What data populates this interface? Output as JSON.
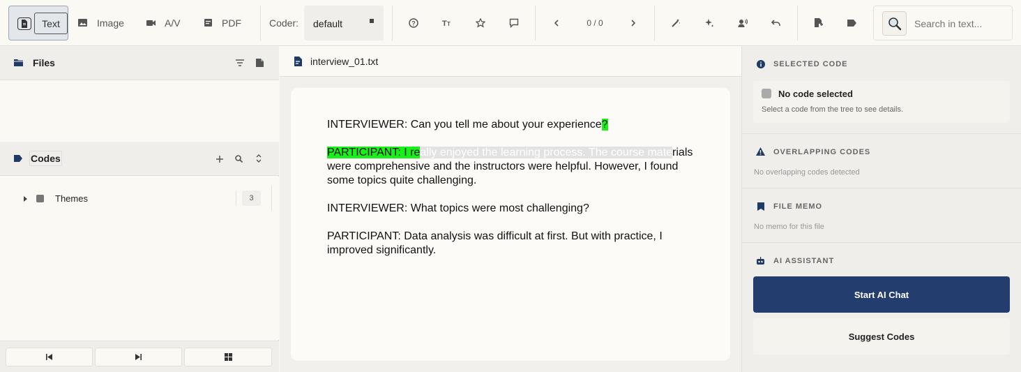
{
  "toolbar": {
    "text_label": "Text",
    "image_label": "Image",
    "av_label": "A/V",
    "pdf_label": "PDF",
    "coder_label": "Coder:",
    "coder_value": "default",
    "nav_counter": "0 / 0",
    "search_placeholder": "Search in text..."
  },
  "files": {
    "title": "Files"
  },
  "codes": {
    "title": "Codes",
    "tree": [
      {
        "label": "Themes",
        "count": "3"
      }
    ]
  },
  "document": {
    "filename": "interview_01.txt",
    "p1_a": "INTERVIEWER: Can you tell me about your experience",
    "p1_hl": "?",
    "p2_hl": "PARTICIPANT: I re",
    "p2_sel": "ally enjoyed the learning process. The course mate",
    "p2_rest": "rials were comprehensive and the instructors were helpful. However, I found some topics quite challenging.",
    "p3": "INTERVIEWER: What topics were most challenging?",
    "p4": "PARTICIPANT: Data analysis was difficult at first. But with practice, I improved significantly.",
    "highlight_color": "#19f019"
  },
  "right_panel": {
    "selected_title": "SELECTED CODE",
    "no_code": "No code selected",
    "no_code_hint": "Select a code from the tree to see details.",
    "overlap_title": "OVERLAPPING CODES",
    "overlap_text": "No overlapping codes detected",
    "memo_title": "FILE MEMO",
    "memo_text": "No memo for this file",
    "ai_title": "AI ASSISTANT",
    "start_ai": "Start AI Chat",
    "suggest": "Suggest Codes"
  }
}
